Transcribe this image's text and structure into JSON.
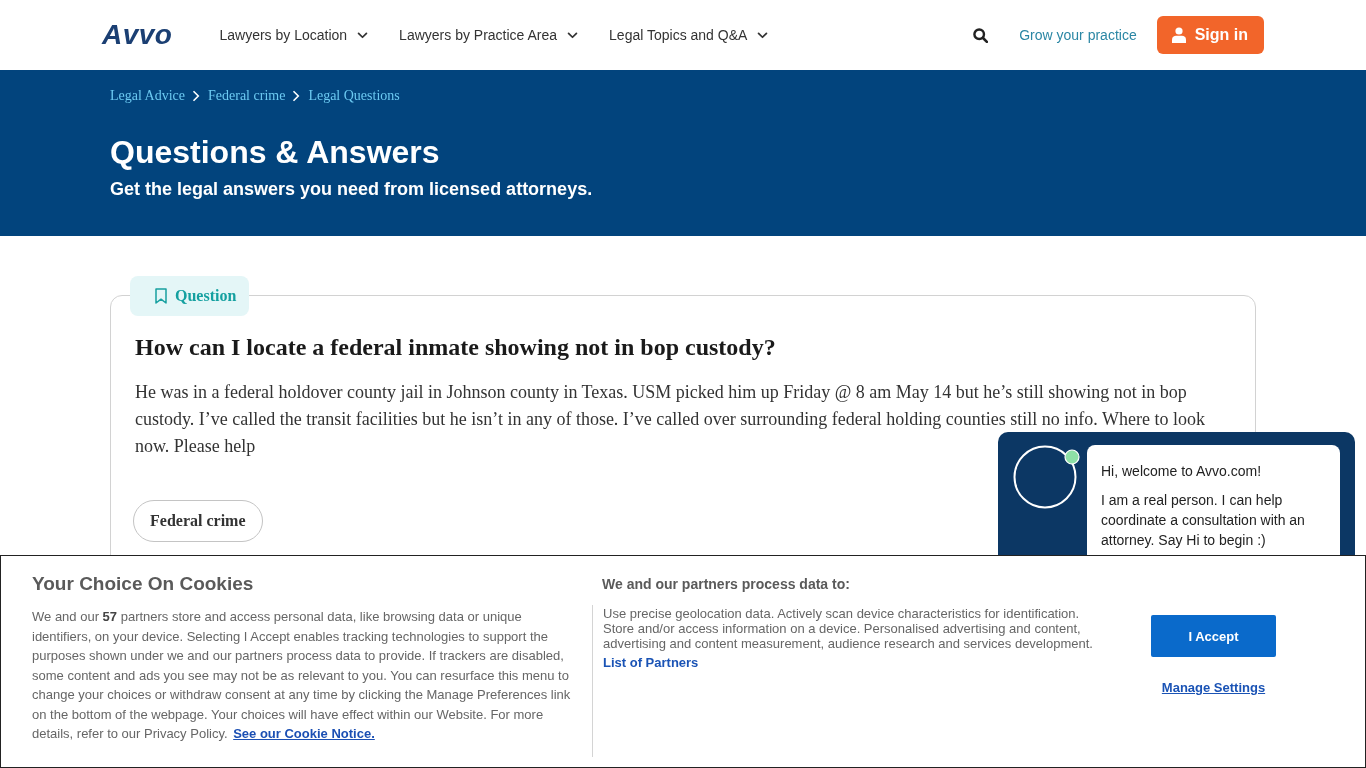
{
  "header": {
    "logo": "Avvo",
    "nav": [
      {
        "label": "Lawyers by Location",
        "expanded": false
      },
      {
        "label": "Lawyers by Practice Area",
        "expanded": false
      },
      {
        "label": "Legal Topics and Q&A",
        "expanded": false
      }
    ],
    "grow_link": "Grow your practice",
    "sign_in": "Sign in"
  },
  "hero": {
    "breadcrumbs": [
      "Legal Advice",
      "Federal crime",
      "Legal Questions"
    ],
    "title": "Questions & Answers",
    "subtitle": "Get the legal answers you need from licensed attorneys."
  },
  "question": {
    "badge": "Question",
    "title": "How can I locate a federal inmate showing not in bop custody?",
    "body": "He was in a federal holdover county jail in Johnson county in Texas. USM picked him up Friday @ 8 am May 14 but he’s still showing not in bop custody. I’ve called the transit facilities but he isn’t in any of those. I’ve called over surrounding federal holding counties still no info. Where to look now. Please help",
    "tags": [
      "Federal crime"
    ]
  },
  "chat": {
    "online": true,
    "messages": [
      "Hi, welcome to Avvo.com!",
      "I am a real person. I can help coordinate a consultation with an attorney. Say Hi to begin :)"
    ]
  },
  "cookies": {
    "title": "Your Choice On Cookies",
    "description": "We and our **57** partners store and access personal data, like browsing data or unique identifiers, on your device. Selecting I Accept enables tracking technologies to support the purposes shown under we and our partners process data to provide. If trackers are disabled, some content and ads you see may not be as relevant to you. You can resurface this menu to change your choices or withdraw consent at any time by clicking the Manage Preferences link on the bottom of the webpage. Your choices will have effect within our Website. For more details, refer to our Privacy Policy.",
    "notice_link": "See our Cookie Notice.",
    "purposes_title": "We and our partners process data to:",
    "purposes": "Use precise geolocation data. Actively scan device characteristics for identification. Store and/or access information on a device. Personalised advertising and content, advertising and content measurement, audience research and services development.",
    "partners_link": "List of Partners",
    "accept": "I Accept",
    "manage": "Manage Settings"
  }
}
